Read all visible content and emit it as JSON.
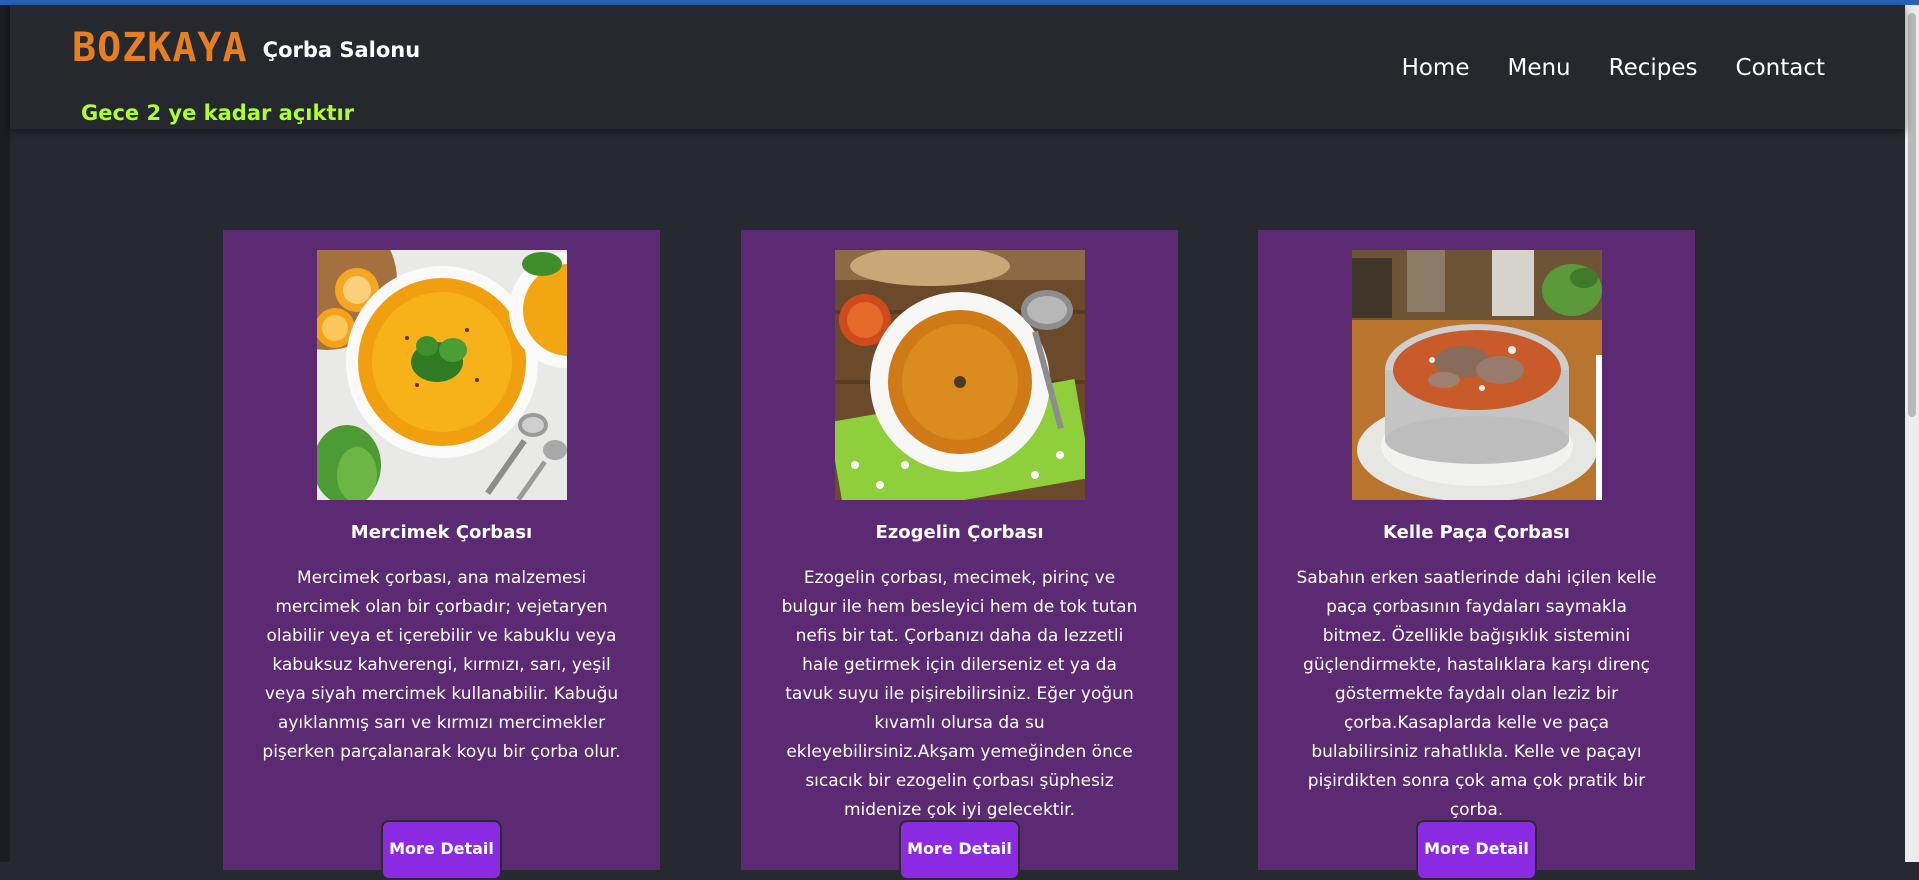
{
  "header": {
    "brand_name": "BOZKAYA",
    "brand_subtitle": "Çorba Salonu",
    "open_hours": "Gece 2 ye kadar açıktır",
    "nav": [
      "Home",
      "Menu",
      "Recipes",
      "Contact"
    ]
  },
  "cards": [
    {
      "title": "Mercimek Çorbası",
      "description": "Mercimek çorbası, ana malzemesi mercimek olan bir çorbadır; vejetaryen olabilir veya et içerebilir ve kabuklu veya kabuksuz kahverengi, kırmızı, sarı, yeşil veya siyah mercimek kullanabilir. Kabuğu ayıklanmış sarı ve kırmızı mercimekler pişerken parçalanarak koyu bir çorba olur.",
      "button": "More Detail"
    },
    {
      "title": "Ezogelin Çorbası",
      "description": "Ezogelin çorbası, mecimek, pirinç ve bulgur ile hem besleyici hem de tok tutan nefis bir tat. Çorbanızı daha da lezzetli hale getirmek için dilerseniz et ya da tavuk suyu ile pişirebilirsiniz. Eğer yoğun kıvamlı olursa da su ekleyebilirsiniz.Akşam yemeğinden önce sıcacık bir ezogelin çorbası şüphesiz midenize çok iyi gelecektir.",
      "button": "More Detail"
    },
    {
      "title": "Kelle Paça Çorbası",
      "description": "Sabahın erken saatlerinde dahi içilen kelle paça çorbasının faydaları saymakla bitmez. Özellikle bağışıklık sistemini güçlendirmekte, hastalıklara karşı direnç göstermekte faydalı olan leziz bir çorba.Kasaplarda kelle ve paça bulabilirsiniz rahatlıkla. Kelle ve paçayı pişirdikten sonra çok ama çok pratik bir çorba.",
      "button": "More Detail"
    }
  ],
  "colors": {
    "page_bg": "#262a30",
    "navbar_bg": "#25282d",
    "brand": "#e67e22",
    "open_hours": "#adff2f",
    "card_bg": "#5c2a72",
    "button_bg": "#8a2be2"
  }
}
